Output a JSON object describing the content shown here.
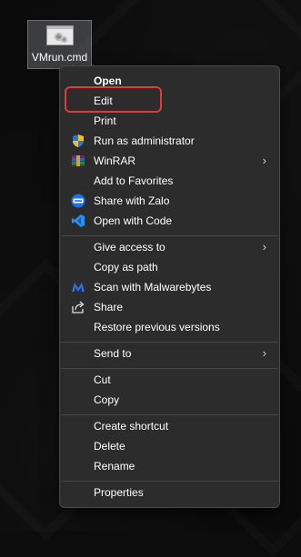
{
  "desktop": {
    "file": {
      "name": "VMrun.cmd",
      "icon": "settings-file-icon"
    }
  },
  "context_menu": {
    "group1": [
      {
        "label": "Open",
        "bold": true
      },
      {
        "label": "Edit"
      },
      {
        "label": "Print"
      },
      {
        "label": "Run as administrator",
        "icon": "shield-icon"
      },
      {
        "label": "WinRAR",
        "icon": "winrar-icon",
        "submenu": true
      },
      {
        "label": "Add to Favorites"
      },
      {
        "label": "Share with Zalo",
        "icon": "zalo-icon"
      },
      {
        "label": "Open with Code",
        "icon": "vscode-icon"
      }
    ],
    "group2": [
      {
        "label": "Give access to",
        "submenu": true
      },
      {
        "label": "Copy as path"
      },
      {
        "label": "Scan with Malwarebytes",
        "icon": "malwarebytes-icon"
      },
      {
        "label": "Share",
        "icon": "share-icon"
      },
      {
        "label": "Restore previous versions"
      }
    ],
    "group3": [
      {
        "label": "Send to",
        "submenu": true
      }
    ],
    "group4": [
      {
        "label": "Cut"
      },
      {
        "label": "Copy"
      }
    ],
    "group5": [
      {
        "label": "Create shortcut"
      },
      {
        "label": "Delete"
      },
      {
        "label": "Rename"
      }
    ],
    "group6": [
      {
        "label": "Properties"
      }
    ],
    "chevron": "›"
  },
  "colors": {
    "menu_bg": "#2c2c2c",
    "highlight_border": "#e03b3b",
    "vscode_blue": "#2a8ff0",
    "zalo_blue": "#1a73e8",
    "malwarebytes_blue": "#2f6fe0"
  }
}
